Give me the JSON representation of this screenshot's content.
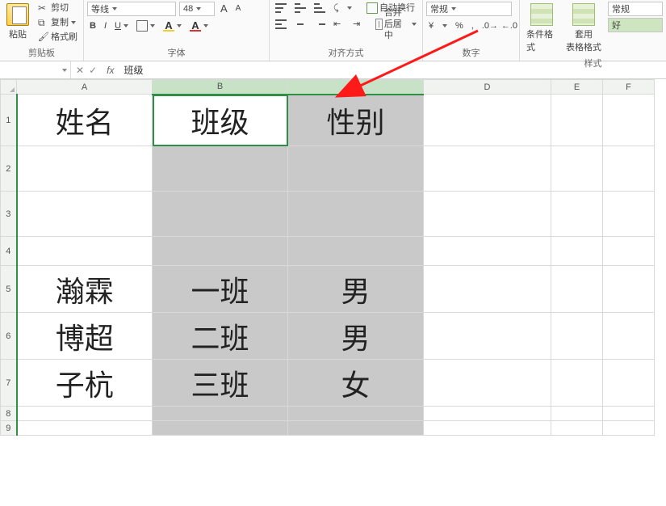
{
  "ribbon": {
    "clipboard": {
      "paste": "粘贴",
      "cut": "剪切",
      "copy": "复制",
      "brush": "格式刷",
      "title": "剪贴板"
    },
    "font": {
      "family": "等线",
      "size": "48",
      "bold": "B",
      "italic": "I",
      "underline": "U",
      "aBig": "A",
      "aSmall": "A",
      "fontColor": "A",
      "fillColor": "A",
      "title": "字体"
    },
    "align": {
      "wrap": "自动换行",
      "merge": "合并后居中",
      "title": "对齐方式"
    },
    "number": {
      "format": "常规",
      "percent": "%",
      "comma": ",",
      "title": "数字"
    },
    "styles": {
      "condFmt": "条件格式",
      "tableFmt": "套用\n表格格式",
      "normal": "常规",
      "good": "好",
      "title": "样式"
    }
  },
  "nameBar": {
    "ref": "",
    "fx": "fx",
    "formula": "班级"
  },
  "colHeaders": [
    "A",
    "B",
    "C",
    "D",
    "E",
    "F"
  ],
  "cells": {
    "header": {
      "A": "姓名",
      "B": "班级",
      "C": "性别"
    },
    "rows": [
      {
        "A": "瀚霖",
        "B": "一班",
        "C": "男"
      },
      {
        "A": "博超",
        "B": "二班",
        "C": "男"
      },
      {
        "A": "子杭",
        "B": "三班",
        "C": "女"
      }
    ]
  },
  "rowNumbers": [
    "1",
    "2",
    "3",
    "4",
    "5",
    "6",
    "7",
    "8",
    "9"
  ],
  "chart_data": {
    "type": "table",
    "columns": [
      "姓名",
      "班级",
      "性别"
    ],
    "rows": [
      [
        "瀚霖",
        "一班",
        "男"
      ],
      [
        "博超",
        "二班",
        "男"
      ],
      [
        "子杭",
        "三班",
        "女"
      ]
    ]
  }
}
